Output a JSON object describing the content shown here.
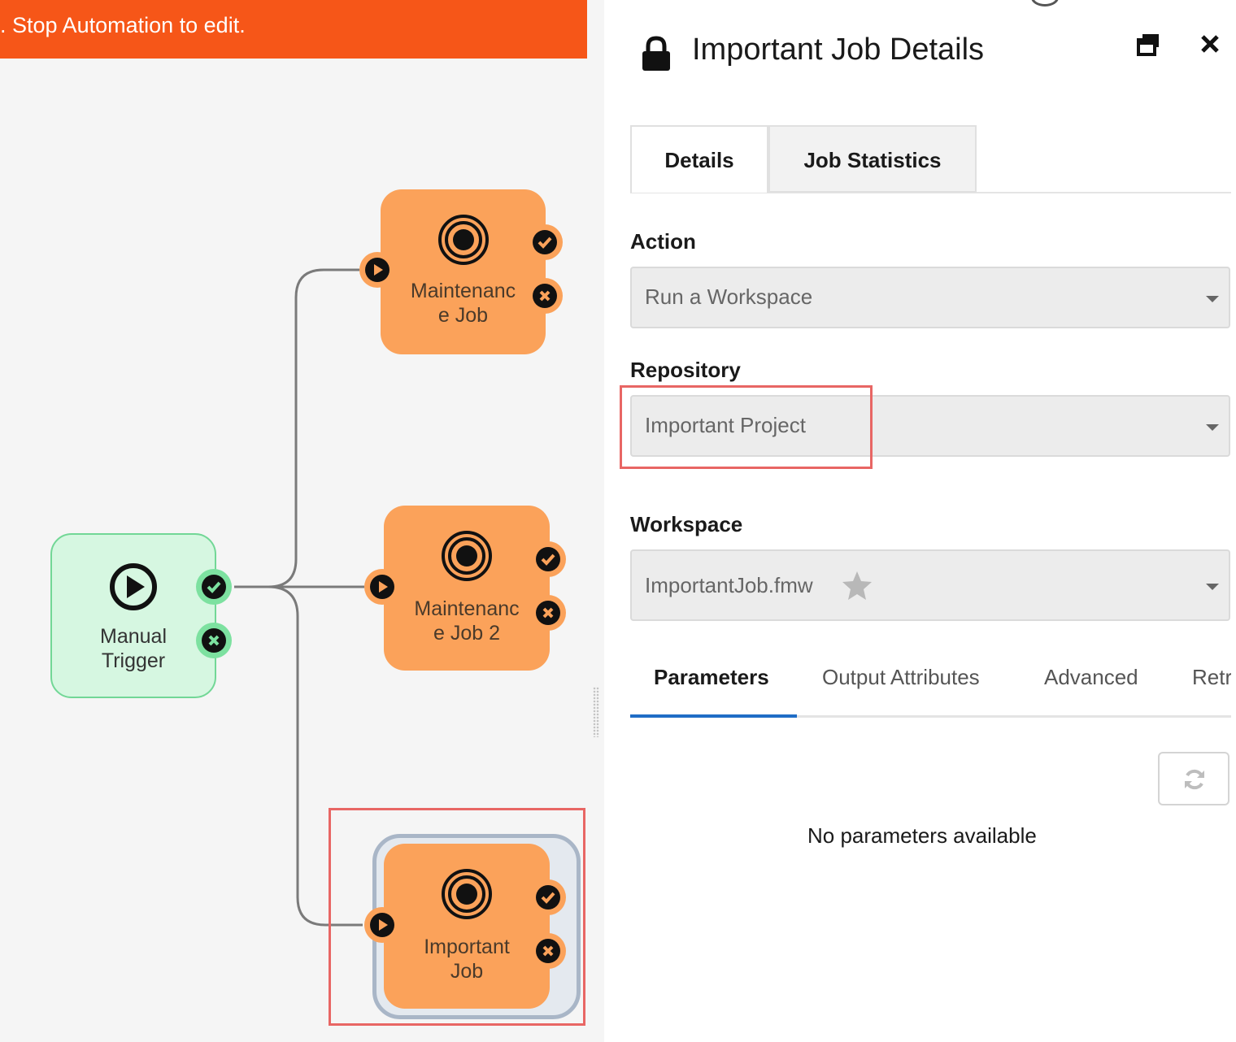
{
  "banner": {
    "text": ". Stop Automation to edit.",
    "color": "#f65618"
  },
  "canvas": {
    "nodes": {
      "trigger": {
        "label_line1": "Manual",
        "label_line2": "Trigger",
        "icon": "play-circle-icon"
      },
      "job1": {
        "label_line1": "Maintenanc",
        "label_line2": "e  Job",
        "icon": "target-icon"
      },
      "job2": {
        "label_line1": "Maintenanc",
        "label_line2": "e  Job 2",
        "icon": "target-icon"
      },
      "job3": {
        "label_line1": "Important",
        "label_line2": "Job",
        "icon": "target-icon",
        "selected": true
      }
    },
    "colors": {
      "job": "#fba25a",
      "trigger": "#d6f7e1",
      "trigger_border": "#72d796",
      "highlight": "#e86664"
    }
  },
  "panel": {
    "title": "Important Job Details",
    "tabs": [
      {
        "label": "Details",
        "active": true
      },
      {
        "label": "Job Statistics",
        "active": false
      }
    ],
    "fields": {
      "action": {
        "label": "Action",
        "value": "Run a Workspace"
      },
      "repository": {
        "label": "Repository",
        "value": "Important Project"
      },
      "workspace": {
        "label": "Workspace",
        "value": "ImportantJob.fmw"
      }
    },
    "subtabs": [
      {
        "label": "Parameters",
        "active": true
      },
      {
        "label": "Output Attributes",
        "active": false
      },
      {
        "label": "Advanced",
        "active": false
      },
      {
        "label": "Retr",
        "active": false
      }
    ],
    "empty_message": "No parameters available",
    "accent": "#1f6dc6"
  }
}
